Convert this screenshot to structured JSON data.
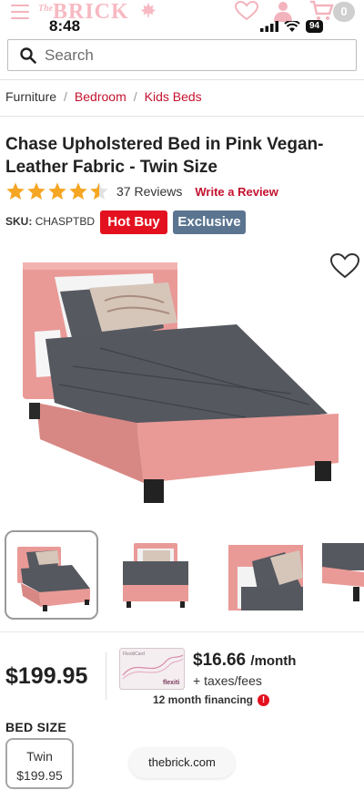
{
  "status": {
    "time": "8:48",
    "battery": "94"
  },
  "header": {
    "logo_the": "The",
    "logo_brick": "BRICK",
    "cart_count": "0"
  },
  "search": {
    "placeholder": "Search"
  },
  "breadcrumb": [
    "Furniture",
    "Bedroom",
    "Kids Beds"
  ],
  "product": {
    "title": "Chase Upholstered Bed in Pink Vegan-Leather Fabric - Twin Size",
    "rating": 4.5,
    "reviews_label": "37 Reviews",
    "write_review": "Write a Review",
    "sku_label": "SKU:",
    "sku": "CHASPTBD",
    "badges": {
      "hot_buy": "Hot Buy",
      "exclusive": "Exclusive"
    },
    "price": "$199.95",
    "monthly_price": "$16.66",
    "monthly_unit": "/month",
    "taxes": "+ taxes/fees",
    "financing": "12 month financing",
    "flexiti_card": {
      "top": "FlexitiCard",
      "brand": "flexiti"
    },
    "bed_size_label": "BED SIZE",
    "size_option": {
      "name": "Twin",
      "price": "$199.95"
    }
  },
  "browser": {
    "url": "thebrick.com"
  },
  "colors": {
    "accent_red": "#c4122f",
    "hot_buy_bg": "#e3111f",
    "exclusive_bg": "#5b7590",
    "star": "#f5a623",
    "bed_pink": "#e99a97"
  }
}
